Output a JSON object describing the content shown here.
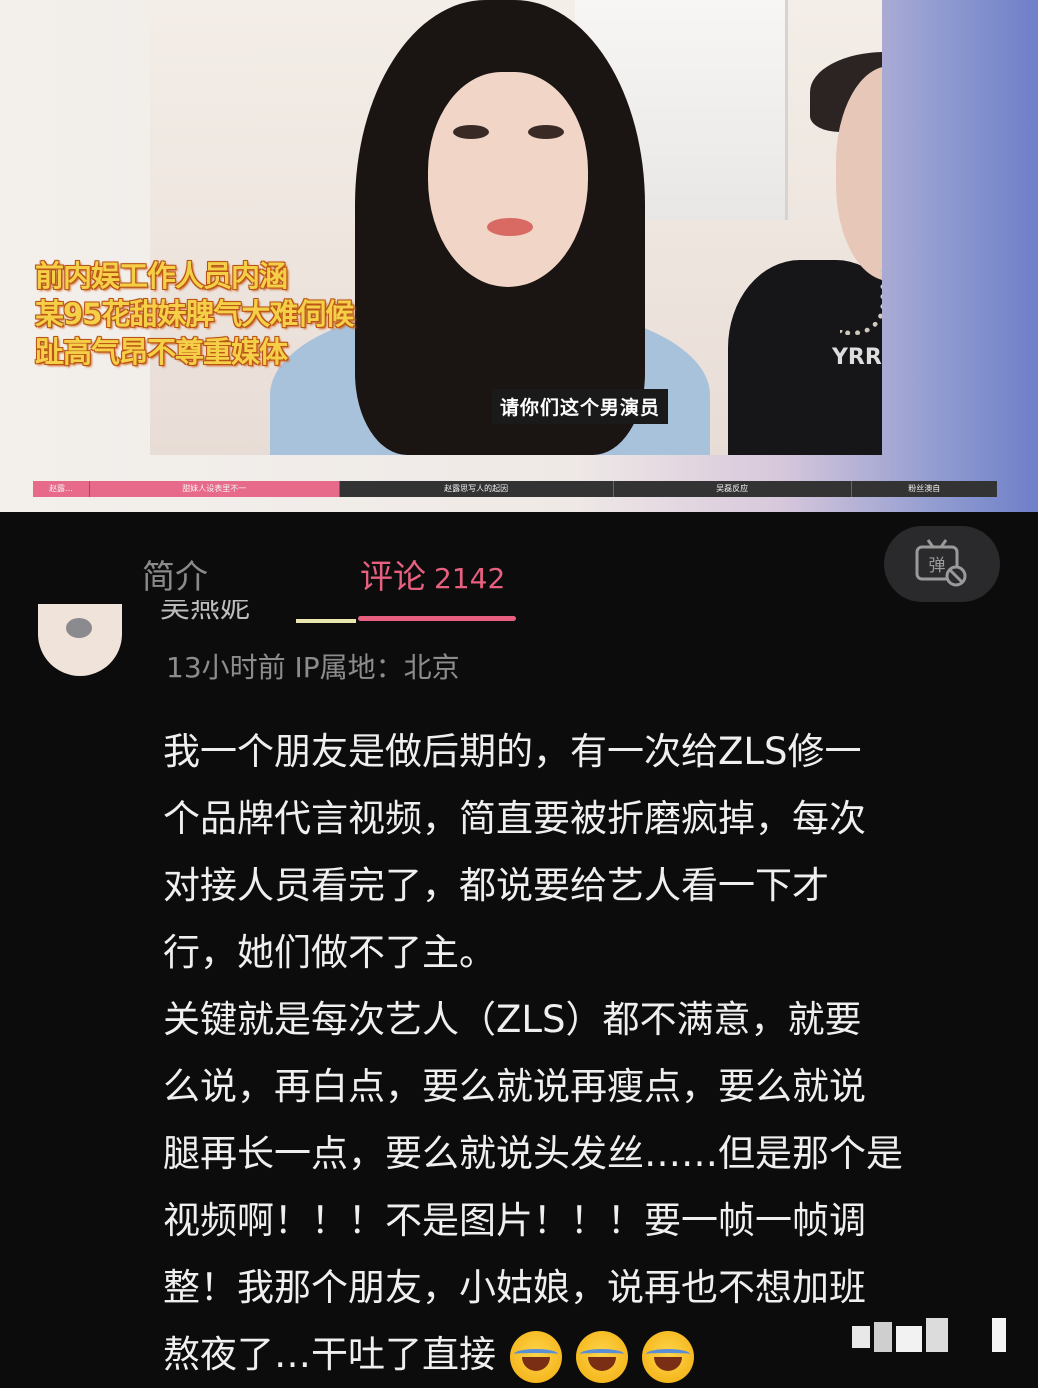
{
  "video": {
    "overlay_lines": [
      "前内娱工作人员内涵",
      "某95花甜妹脾气大难伺候",
      "趾高气昂不尊重媒体"
    ],
    "subtitle": "请你们这个男演员",
    "shirt_logo": "YRR",
    "chapters": [
      {
        "label": "赵露...",
        "active": true
      },
      {
        "label": "甜妹人设表里不一",
        "active": true
      },
      {
        "label": "赵露思写人的起因",
        "active": false
      },
      {
        "label": "吴磊反应",
        "active": false
      },
      {
        "label": "粉丝澳自",
        "active": false
      }
    ]
  },
  "tabs": {
    "intro_label": "简介",
    "comments_label": "评论",
    "comments_count": "2142",
    "danmaku_icon": "danmaku-toggle-icon",
    "danmaku_glyph": "弹"
  },
  "comment": {
    "username": "吴燕妮",
    "meta": "13小时前  IP属地：北京",
    "lines": [
      "我一个朋友是做后期的，有一次给ZLS修一",
      "个品牌代言视频，简直要被折磨疯掉，每次",
      "对接人员看完了，都说要给艺人看一下才",
      "行，她们做不了主。",
      "关键就是每次艺人（ZLS）都不满意，就要",
      "么说，再白点，要么就说再瘦点，要么就说",
      "腿再长一点，要么就说头发丝……但是那个是",
      "视频啊！！！不是图片！！！要一帧一帧调",
      "整！我那个朋友，小姑娘，说再也不想加班"
    ],
    "last_line": "熬夜了…干吐了直接",
    "emojis": [
      "crying-laughing-emoji",
      "crying-laughing-emoji",
      "crying-laughing-emoji"
    ]
  },
  "colors": {
    "accent_pink": "#e7607f",
    "background": "#0c0c0d",
    "overlay_yellow": "#f4cf47"
  }
}
